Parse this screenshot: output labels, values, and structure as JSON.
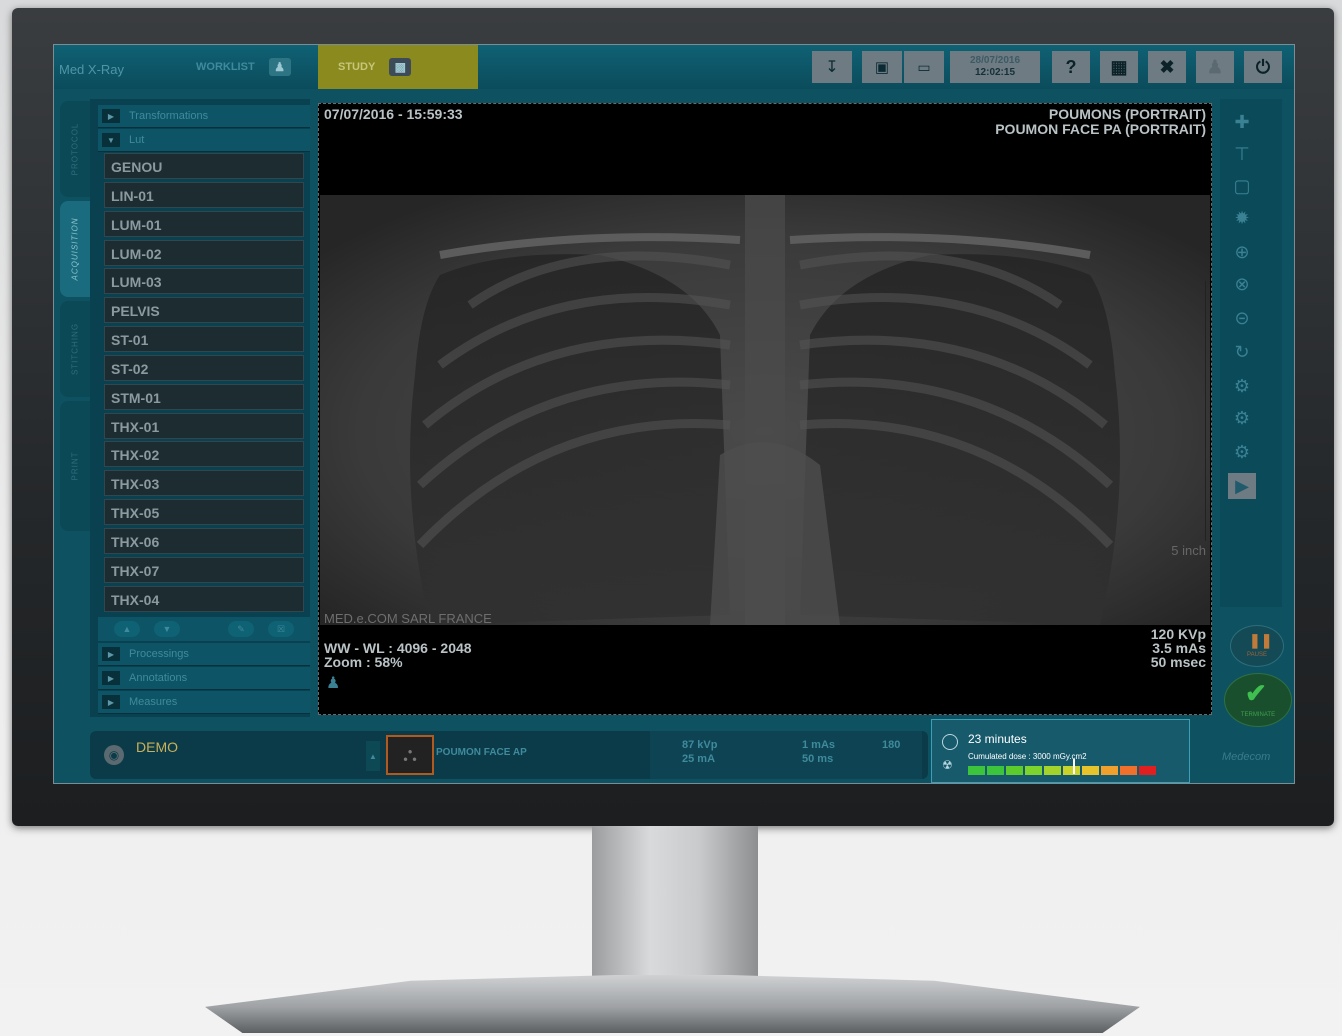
{
  "header": {
    "brand_prefix": "Med",
    "brand_suffix": "X-Ray",
    "worklist_label": "WORKLIST",
    "study_label": "STUDY",
    "date": "28/07/2016",
    "time": "12:02:15",
    "icons": [
      "stitch-icon",
      "exposure-icon",
      "detector-icon",
      "help-icon",
      "patient-file-icon",
      "settings-icon",
      "user-icon",
      "power-icon"
    ]
  },
  "side_tabs": [
    "PROTOCOL",
    "ACQUISITION",
    "STITCHING",
    "PRINT"
  ],
  "left_panel": {
    "groups_top": [
      "Transformations",
      "Lut"
    ],
    "lut_items": [
      "GENOU",
      "LIN-01",
      "LUM-01",
      "LUM-02",
      "LUM-03",
      "PELVIS",
      "ST-01",
      "ST-02",
      "STM-01",
      "THX-01",
      "THX-02",
      "THX-03",
      "THX-05",
      "THX-06",
      "THX-07",
      "THX-04"
    ],
    "groups_bottom": [
      "Processings",
      "Annotations",
      "Measures"
    ]
  },
  "viewer": {
    "datetime": "07/07/2016 - 15:59:33",
    "title_line1": "POUMONS (PORTRAIT)",
    "title_line2": "POUMON FACE PA (PORTRAIT)",
    "institution": "MED.e.COM SARL FRANCE",
    "ww_wl": "WW - WL : 4096 - 2048",
    "zoom": "Zoom : 58%",
    "kvp": "120 KVp",
    "mas": "3.5 mAs",
    "msec": "50 msec",
    "scale_label": "5 inch"
  },
  "bottom": {
    "patient": "DEMO",
    "thumb_label": "POUMON FACE AP",
    "kvp": "87 kVp",
    "ma": "25 mA",
    "mas": "1 mAs",
    "ms": "50 ms",
    "sid": "180",
    "dose_time": "23 minutes",
    "dose_text": "Cumulated dose : 3000 mGy.cm2",
    "dose_level": 0.55,
    "pause_label": "PAUSE",
    "terminate_label": "TERMINATE",
    "vendor": "Medecom"
  },
  "colors": {
    "accent": "#0f6174",
    "study": "#8a8a1e",
    "dose_green": "#3cc43c",
    "dose_red": "#e02020"
  }
}
